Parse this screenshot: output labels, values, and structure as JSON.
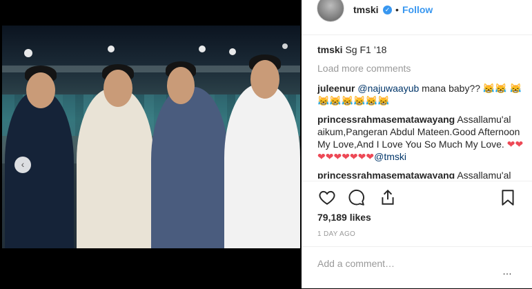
{
  "post": {
    "username": "tmski",
    "follow_label": "Follow",
    "separator": "•",
    "caption_user": "tmski",
    "caption_text": "Sg F1 ’18",
    "load_more": "Load more comments",
    "likes": "79,189 likes",
    "time": "1 DAY AGO",
    "add_comment_placeholder": "Add a comment…",
    "more_label": "…"
  },
  "comments": [
    {
      "user": "juleenur",
      "mention": "@najuwaayub",
      "text": " mana baby?? 😹😹 😹😹😹😹😹😹😹"
    },
    {
      "user": "princessrahmasematawayang",
      "text": " Assallamu'al aikum,Pangeran Abdul Mateen.Good Afternoon My Love,And I Love You So Much My Love.",
      "hearts": "❤❤❤❤❤❤❤❤❤",
      "mention": "@tmski"
    },
    {
      "user": "princessrahmasematawayang",
      "text": " Assallamu'al"
    }
  ],
  "icons": {
    "verified": "verified-badge",
    "like": "heart-outline",
    "comment": "speech-bubble",
    "share": "upload-share",
    "save": "bookmark",
    "photo_prev": "chevron-left"
  },
  "colors": {
    "link": "#3897f0",
    "text": "#262626",
    "muted": "#999999",
    "heart": "#ed4956"
  }
}
